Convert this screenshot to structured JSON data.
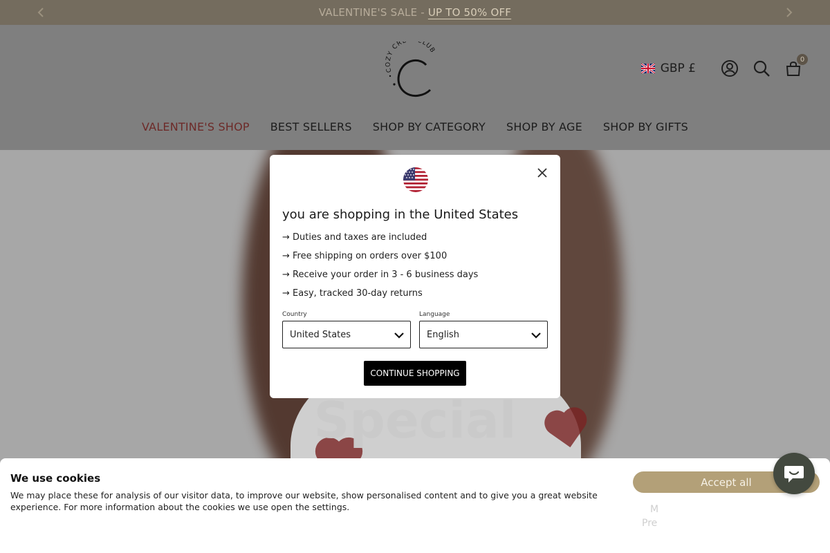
{
  "announcement": {
    "prefix": "VALENTINE'S SALE - ",
    "highlight": "UP TO 50% OFF"
  },
  "header": {
    "logo_text": "COZY CREW CLUB",
    "currency": "GBP £",
    "cart_count": "0"
  },
  "nav": {
    "items": [
      {
        "label": "VALENTINE'S SHOP"
      },
      {
        "label": "BEST SELLERS"
      },
      {
        "label": "SHOP BY CATEGORY"
      },
      {
        "label": "SHOP BY AGE"
      },
      {
        "label": "SHOP BY GIFTS"
      }
    ]
  },
  "hero": {
    "title_bottom": "Special"
  },
  "modal": {
    "heading": "you are shopping in the United States",
    "benefits": [
      "→ Duties and taxes are included",
      "→ Free shipping on orders over $100",
      "→ Receive your order in 3 - 6 business days",
      "→ Easy, tracked 30-day returns"
    ],
    "country_label": "Country",
    "country_value": "United States",
    "language_label": "Language",
    "language_value": "English",
    "continue_label": "CONTINUE SHOPPING"
  },
  "cookie": {
    "title": "We use cookies",
    "text": "We may place these for analysis of our visitor data, to improve our website, show personalised content and to give you a great website experience. For more information about the cookies we use open the settings.",
    "accept_label": "Accept all",
    "pref_line1": "M",
    "pref_line2": "Pre"
  },
  "colors": {
    "announcement_bg": "#746c5e",
    "accent_gold": "#b3a078",
    "nav_active": "#6d2a28",
    "chat_bg": "#43493f"
  }
}
